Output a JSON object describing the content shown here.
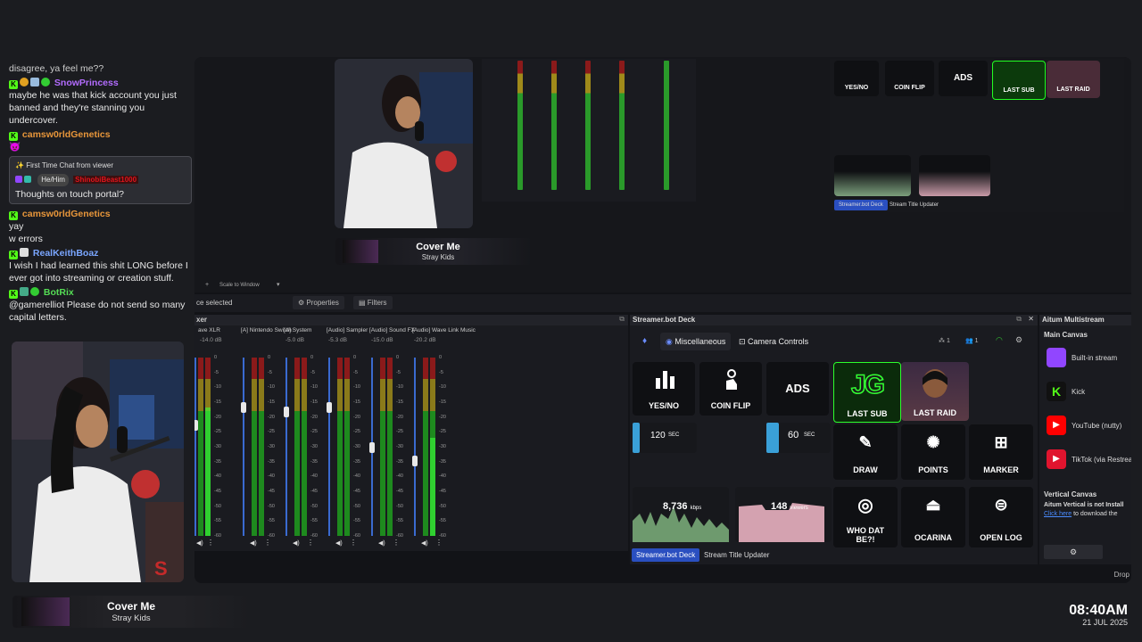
{
  "chat": {
    "partial_top": "disagree, ya feel me??",
    "messages": [
      {
        "user": "SnowPrincess",
        "user_color": "#b36cff",
        "text": "maybe he was that kick account you just banned and they're stanning you undercover."
      },
      {
        "user": "camsw0rldGenetics",
        "user_color": "#e8963a",
        "text": "😈"
      },
      {
        "user": "camsw0rldGenetics",
        "user_color": "#e8963a",
        "text": "yay"
      },
      {
        "user": "",
        "user_color": "#e8963a",
        "text": "w errors"
      },
      {
        "user": "RealKeithBoaz",
        "user_color": "#7aa6ff",
        "text": "I wish I had learned this shit LONG before I ever got into streaming or creation stuff."
      },
      {
        "user": "BotRix",
        "user_color": "#55dd55",
        "text": "@gamerelliot Please do not send so many capital letters."
      }
    ],
    "first_time": {
      "header": "First Time Chat from viewer",
      "pronoun": "He/Him",
      "user": "ShinobiBeast1000",
      "text": "Thoughts on touch portal?"
    }
  },
  "now_playing": {
    "title": "Cover Me",
    "artist": "Stray Kids"
  },
  "clock": {
    "time": "08:40AM",
    "date": "21 JUL 2025"
  },
  "obs": {
    "toolbar": {
      "scale": "Scale to Window",
      "selected": "ce selected",
      "properties": "Properties",
      "filters": "Filters"
    },
    "mixer": {
      "title": "xer",
      "channels": [
        {
          "name": "ave XLR",
          "db": "-14.0 dB",
          "level": 0.72
        },
        {
          "name": "[A] Nintendo Switch",
          "db": "",
          "level": 0.0
        },
        {
          "name": "[A] System",
          "db": "-5.0 dB",
          "level": 0.0
        },
        {
          "name": "[Audio] Sampler",
          "db": "-5.3 dB",
          "level": 0.0
        },
        {
          "name": "[Audio] Sound FX",
          "db": "-15.0 dB",
          "level": 0.0
        },
        {
          "name": "[Audio] Wave Link Music",
          "db": "-20.2 dB",
          "level": 0.55
        }
      ],
      "ticks": [
        "0",
        "-5",
        "-10",
        "-15",
        "-20",
        "-25",
        "-30",
        "-35",
        "-40",
        "-45",
        "-50",
        "-55",
        "-60"
      ]
    },
    "deck": {
      "title": "Streamer.bot Deck",
      "tabs": [
        "Miscellaneous",
        "Camera Controls"
      ],
      "counters": [
        "1",
        "1"
      ],
      "buttons": {
        "yes_no": "YES/NO",
        "coin_flip": "COIN FLIP",
        "ads": "ADS",
        "last_sub": "LAST SUB",
        "last_raid": "LAST RAID",
        "timer1": "120",
        "timer1_unit": "SEC",
        "timer2": "60",
        "timer2_unit": "SEC",
        "draw": "DRAW",
        "points": "POINTS",
        "marker": "MARKER",
        "kbps": "8,736",
        "kbps_unit": "kbps",
        "viewers": "148",
        "viewers_unit": "viewers",
        "who": "WHO DAT BE?!",
        "ocarina": "OCARINA",
        "open_log": "OPEN LOG"
      },
      "bottom_tabs": [
        "Streamer.bot Deck",
        "Stream Title Updater"
      ]
    },
    "multistream": {
      "title": "Aitum Multistream",
      "main_canvas": "Main Canvas",
      "outputs": [
        {
          "name": "Built-in stream",
          "color": "#9146ff",
          "icon": "twitch-icon"
        },
        {
          "name": "Kick",
          "color": "#53fc18",
          "icon": "kick-icon"
        },
        {
          "name": "YouTube (nutty)",
          "color": "#ff0000",
          "icon": "youtube-icon"
        },
        {
          "name": "TikTok (via Restrea",
          "color": "#e0142e",
          "icon": "restream-icon"
        }
      ],
      "vertical_canvas": "Vertical Canvas",
      "vertical_msg": "Aitum Vertical is not Install",
      "click_here": "Click here",
      "click_rest": "to download the"
    },
    "drop": "Drop"
  }
}
